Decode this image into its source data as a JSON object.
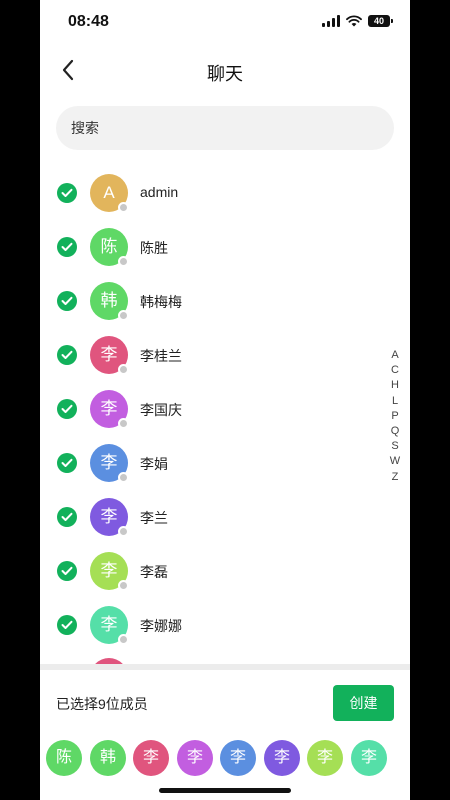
{
  "status_bar": {
    "time": "08:48",
    "battery": "40"
  },
  "nav": {
    "title": "聊天"
  },
  "search": {
    "placeholder": "搜索"
  },
  "contacts": [
    {
      "initial": "A",
      "name": "admin",
      "color": "#e2b55c"
    },
    {
      "initial": "陈",
      "name": "陈胜",
      "color": "#5fd866"
    },
    {
      "initial": "韩",
      "name": "韩梅梅",
      "color": "#5fd866"
    },
    {
      "initial": "李",
      "name": "李桂兰",
      "color": "#e0557e"
    },
    {
      "initial": "李",
      "name": "李国庆",
      "color": "#c25ee0"
    },
    {
      "initial": "李",
      "name": "李娟",
      "color": "#5b8fe0"
    },
    {
      "initial": "李",
      "name": "李兰",
      "color": "#7f5ae0"
    },
    {
      "initial": "李",
      "name": "李磊",
      "color": "#a5df55"
    },
    {
      "initial": "李",
      "name": "李娜娜",
      "color": "#55dfa8"
    }
  ],
  "alphabet_index": [
    "A",
    "C",
    "H",
    "L",
    "P",
    "Q",
    "S",
    "W",
    "Z"
  ],
  "bottom": {
    "selected_text": "已选择9位成员",
    "create_label": "创建",
    "selected_avatars": [
      {
        "initial": "陈",
        "color": "#5fd866"
      },
      {
        "initial": "韩",
        "color": "#5fd866"
      },
      {
        "initial": "李",
        "color": "#e0557e"
      },
      {
        "initial": "李",
        "color": "#c25ee0"
      },
      {
        "initial": "李",
        "color": "#5b8fe0"
      },
      {
        "initial": "李",
        "color": "#7f5ae0"
      },
      {
        "initial": "李",
        "color": "#a5df55"
      },
      {
        "initial": "李",
        "color": "#55dfa8"
      }
    ]
  },
  "colors": {
    "accent": "#12b15b",
    "search_bg": "#f2f2f2",
    "partial_avatar": "#e0557e"
  }
}
